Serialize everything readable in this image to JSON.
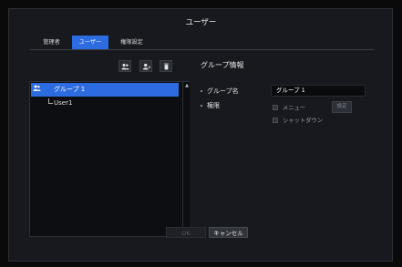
{
  "dialog": {
    "title": "ユーザー"
  },
  "tabs": [
    {
      "label": "管理者",
      "active": false
    },
    {
      "label": "ユーザー",
      "active": true
    },
    {
      "label": "権限設定",
      "active": false
    }
  ],
  "toolbar": {
    "add_group_icon": "add-group-icon",
    "add_user_icon": "add-user-icon",
    "delete_icon": "trash-icon"
  },
  "tree": {
    "group_label": "グループ 1",
    "child_label": "User1"
  },
  "info": {
    "section_title": "グループ情報",
    "group_name_label": "グループ名",
    "group_name_value": "グループ 1",
    "permission_label": "権限",
    "menu_checkbox_label": "メニュー",
    "menu_settings_button": "設定",
    "shutdown_checkbox_label": "シャットダウン"
  },
  "footer": {
    "ok_label": "OK",
    "cancel_label": "キャンセル"
  },
  "colors": {
    "accent": "#2d6be0",
    "panel": "#17191e",
    "background": "#0a0a0b"
  }
}
